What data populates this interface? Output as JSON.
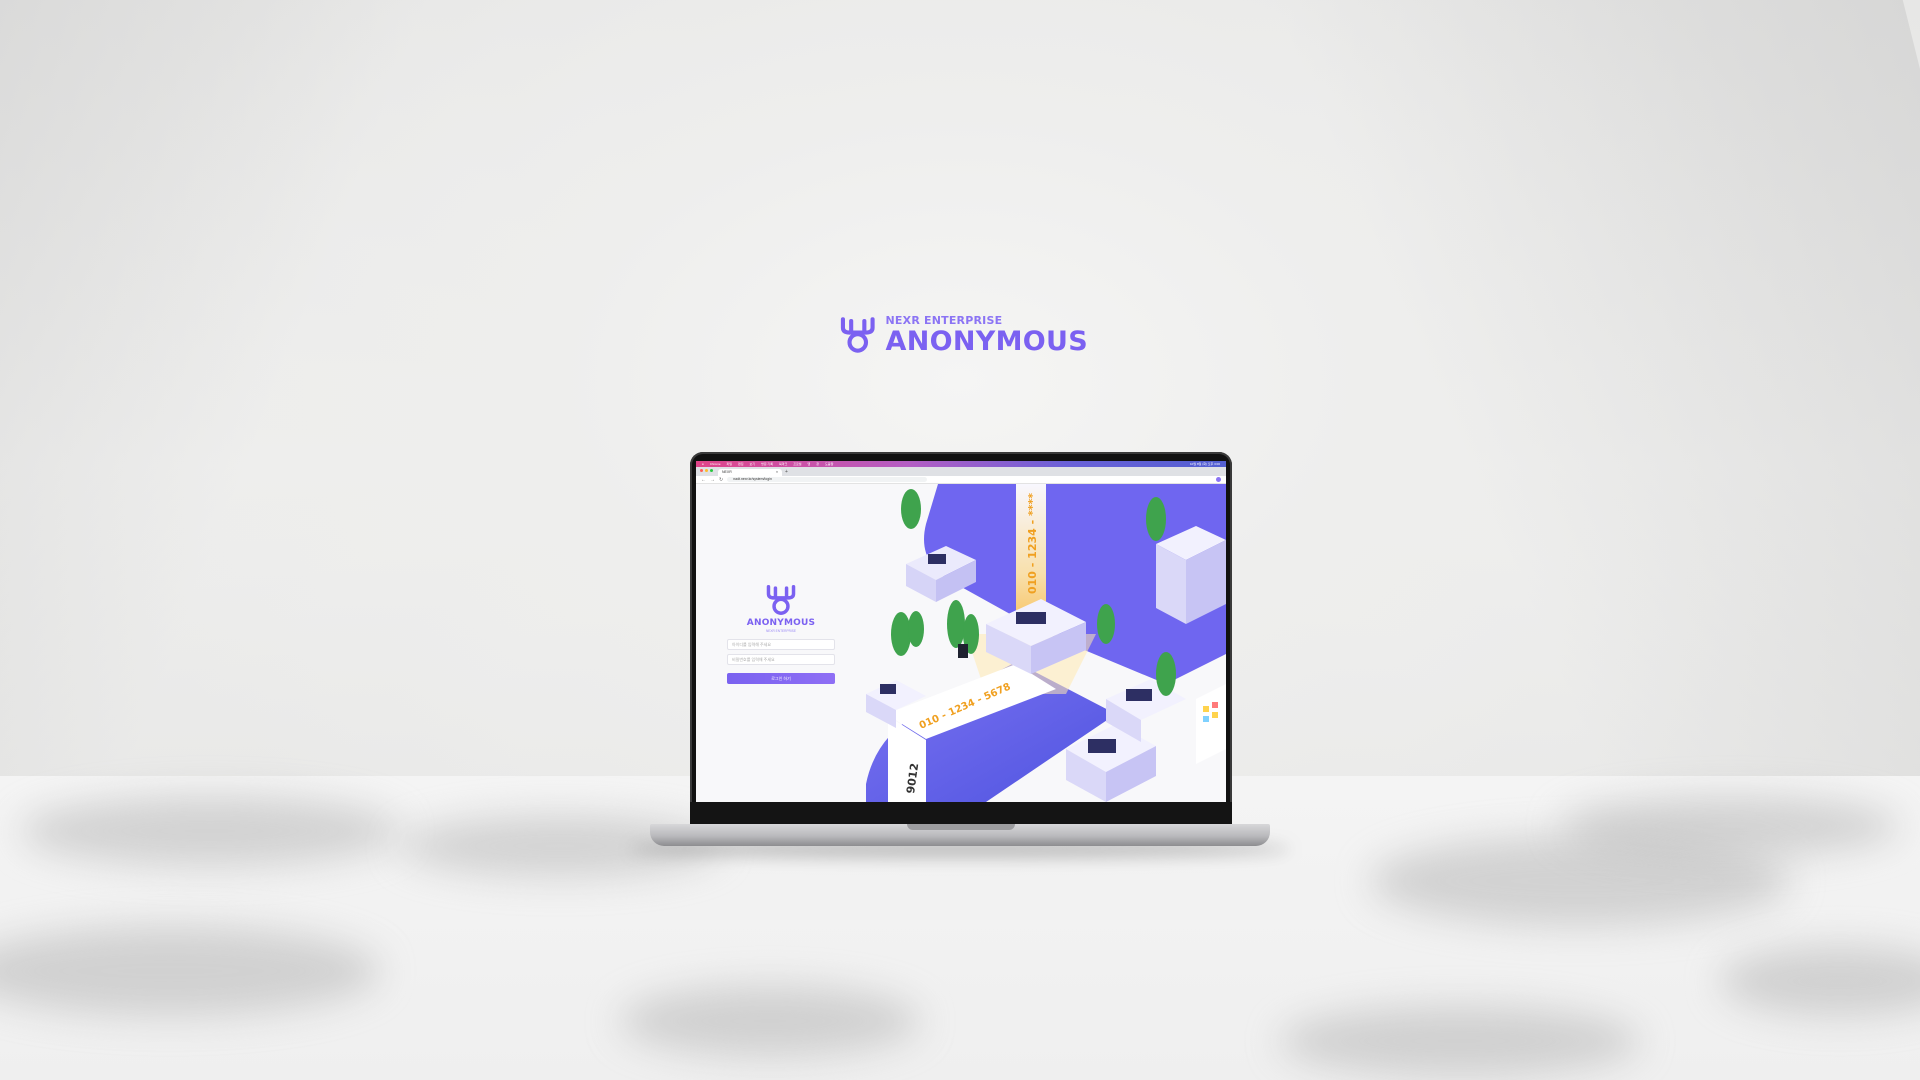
{
  "brand": {
    "subtitle": "NEXR ENTERPRISE",
    "title": "ANONYMOUS",
    "color": "#7b61f1",
    "icon": "antler-logo-icon"
  },
  "menubar": {
    "items": [
      "Chrome",
      "파일",
      "편집",
      "보기",
      "방문 기록",
      "북마크",
      "프로필",
      "탭",
      "창",
      "도움말"
    ],
    "clock": "10월 8일 (화) 오후 3:00"
  },
  "browser": {
    "tab_title": "NEXR",
    "tab_close": "×",
    "new_tab": "+",
    "url": "nadt.nexr.kr/system/login",
    "back": "←",
    "forward": "→",
    "reload": "↻"
  },
  "login": {
    "title": "ANONYMOUS",
    "subtitle": "NEXR ENTERPRISE",
    "id_placeholder": "아이디를 입력해 주세요",
    "pw_placeholder": "비밀번호를 입력해 주세요",
    "submit_label": "로그인 하기"
  },
  "illustration": {
    "number_strip_main": "010 - 1234 - 5678",
    "number_strip_vertical": "010 - 1234 - ****",
    "number_strip_side": "9012",
    "accent": "#6f66f0"
  }
}
